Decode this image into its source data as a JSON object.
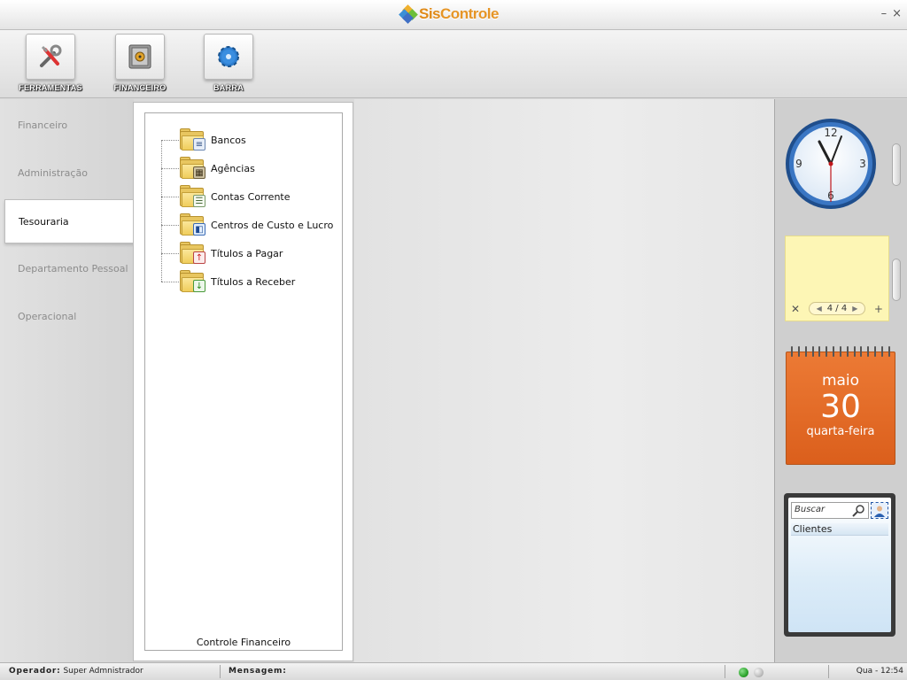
{
  "app": {
    "title_part1": "Sis",
    "title_part2": "Controle"
  },
  "window": {
    "minimize": "–",
    "close": "×"
  },
  "toolbar": {
    "items": [
      {
        "label": "FERRAMENTAS",
        "icon": "tools-icon"
      },
      {
        "label": "FINANCEIRO",
        "icon": "safe-icon"
      },
      {
        "label": "BARRA",
        "icon": "gear-icon"
      }
    ]
  },
  "nav": {
    "items": [
      {
        "label": "Financeiro"
      },
      {
        "label": "Administração"
      },
      {
        "label": "Tesouraria",
        "active": true
      },
      {
        "label": "Departamento Pessoal"
      },
      {
        "label": "Operacional"
      }
    ]
  },
  "tree": {
    "items": [
      {
        "label": "Bancos",
        "icon": "bank-icon"
      },
      {
        "label": "Agências",
        "icon": "building-icon"
      },
      {
        "label": "Contas Corrente",
        "icon": "ledger-icon"
      },
      {
        "label": "Centros de Custo e Lucro",
        "icon": "book-icon"
      },
      {
        "label": "Títulos a Pagar",
        "icon": "arrow-up-icon"
      },
      {
        "label": "Títulos a Receber",
        "icon": "arrow-down-icon"
      }
    ],
    "footer": "Controle Financeiro"
  },
  "widgets": {
    "clock": {
      "numbers": [
        "12",
        "3",
        "6",
        "9"
      ]
    },
    "note": {
      "pager": "4 / 4",
      "close": "✕",
      "add": "+"
    },
    "calendar": {
      "month": "maio",
      "day": "30",
      "weekday": "quarta-feira"
    },
    "search": {
      "placeholder": "Buscar",
      "row": "Clientes"
    }
  },
  "status": {
    "operator_label": "Operador:",
    "operator_value": "Super Admnistrador",
    "message_label": "Mensagem:",
    "time": "Qua - 12:54"
  },
  "colors": {
    "calendar": "#e16a26",
    "note": "#fdf6b5",
    "led_on": "#2fa52f",
    "led_off": "#bfbfbf"
  }
}
